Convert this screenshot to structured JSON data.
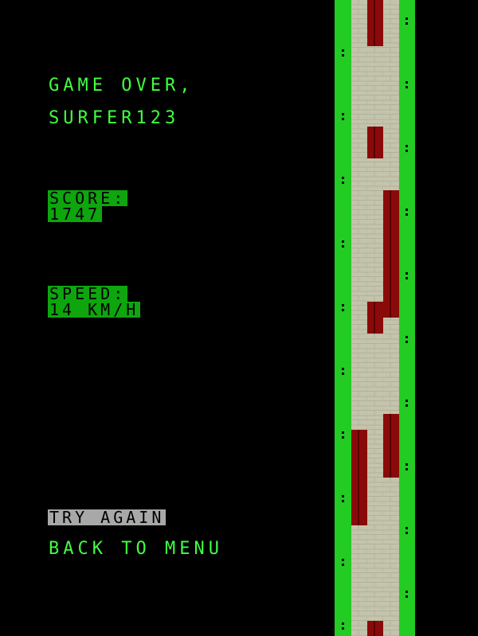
{
  "game_over": {
    "line1": "GAME OVER,",
    "line2": "SURFER123"
  },
  "stats": {
    "score_label": "SCORE:",
    "score_value": "1747",
    "speed_label": "SPEED:",
    "speed_value": "14 KM/H"
  },
  "menu": {
    "try_again": "TRY AGAIN",
    "back_to_menu": "BACK TO MENU"
  },
  "colors": {
    "background": "#000000",
    "text": "#40ff40",
    "highlight": "#0ea50e",
    "grass": "#22cc22",
    "road": "#c4c4ac",
    "obstacle": "#8a0a0a",
    "selected": "#a8a8a8"
  }
}
